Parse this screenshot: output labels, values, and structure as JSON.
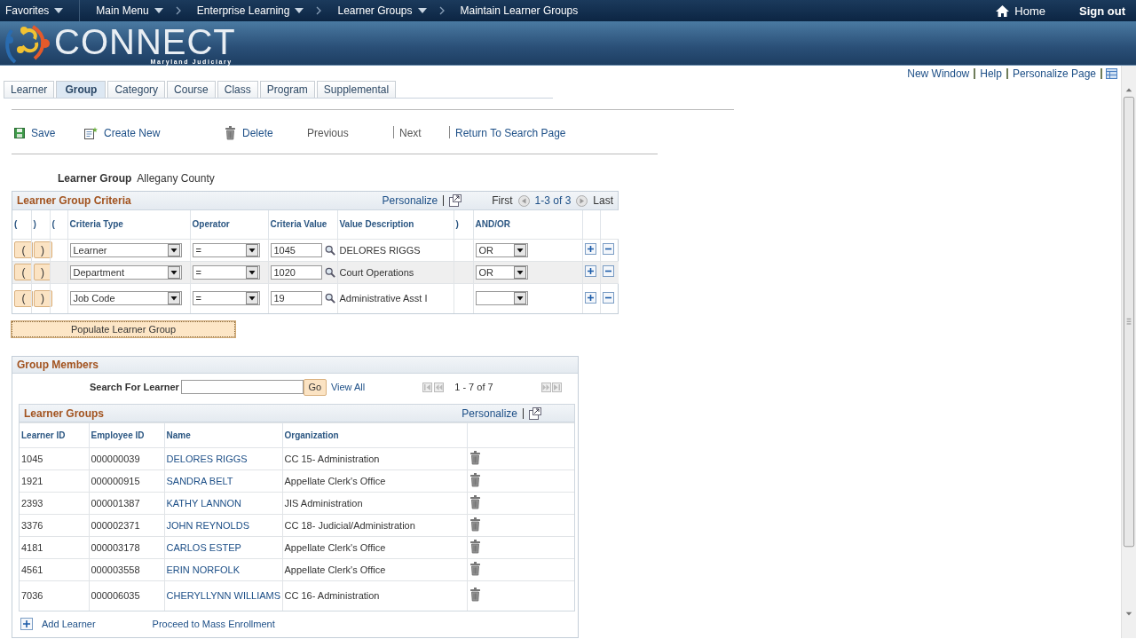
{
  "nav": {
    "items": [
      {
        "label": "Favorites",
        "menu": true,
        "divider_after": true
      },
      {
        "label": "Main Menu",
        "menu": true,
        "divider_after": false
      },
      {
        "label": "Enterprise Learning",
        "menu": true,
        "divider_after": false
      },
      {
        "label": "Learner Groups",
        "menu": true,
        "divider_after": false
      },
      {
        "label": "Maintain Learner Groups",
        "menu": false,
        "divider_after": false
      }
    ],
    "home": "Home",
    "sign_out": "Sign out"
  },
  "banner": {
    "logo_text": "CONNECT",
    "logo_subtitle": "Maryland Judiciary"
  },
  "page_links": [
    "New Window",
    "Help",
    "Personalize Page"
  ],
  "tabs": [
    {
      "label": "Learner",
      "selected": false
    },
    {
      "label": "Group",
      "selected": true
    },
    {
      "label": "Category",
      "selected": false
    },
    {
      "label": "Course",
      "selected": false
    },
    {
      "label": "Class",
      "selected": false
    },
    {
      "label": "Program",
      "selected": false
    },
    {
      "label": "Supplemental",
      "selected": false
    }
  ],
  "toolbar": [
    {
      "label": "Save",
      "kind": "save",
      "disabled": false,
      "divider_before": false
    },
    {
      "label": "Create New",
      "kind": "create",
      "disabled": false,
      "divider_before": false
    },
    {
      "label": "Delete",
      "kind": "delete",
      "disabled": false,
      "divider_before": false
    },
    {
      "label": "Previous",
      "kind": "nav",
      "disabled": true,
      "divider_before": false
    },
    {
      "label": "Next",
      "kind": "nav",
      "disabled": true,
      "divider_before": true
    },
    {
      "label": "Return To Search Page",
      "kind": "nav",
      "disabled": false,
      "divider_before": true
    }
  ],
  "learner_group": {
    "label": "Learner Group",
    "value": "Allegany County"
  },
  "criteria": {
    "title": "Learner Group Criteria",
    "personalize": "Personalize",
    "first": "First",
    "range": "1-3 of 3",
    "last": "Last",
    "columns": [
      "(",
      ")",
      "(",
      "Criteria Type",
      "Operator",
      "Criteria Value",
      "Value Description",
      ")",
      "AND/OR"
    ],
    "rows": [
      {
        "open": "(",
        "close": ")",
        "criteria_type": "Learner",
        "operator": "=",
        "value": "1045",
        "description": "DELORES RIGGS",
        "and_or": "OR",
        "selected": false
      },
      {
        "open": "(",
        "close": ")",
        "criteria_type": "Department",
        "operator": "=",
        "value": "1020",
        "description": "Court Operations",
        "and_or": "OR",
        "selected": true
      },
      {
        "open": "(",
        "close": ")",
        "criteria_type": "Job Code",
        "operator": "=",
        "value": "19",
        "description": "Administrative Asst I",
        "selected": false
      }
    ]
  },
  "populate_button": "Populate Learner Group",
  "members": {
    "title": "Group Members",
    "search_label": "Search For Learner",
    "go": "Go",
    "view_all": "View All",
    "range": "1 - 7 of 7",
    "grid": {
      "title": "Learner Groups",
      "personalize": "Personalize",
      "columns": [
        "Learner ID",
        "Employee ID",
        "Name",
        "Organization"
      ],
      "rows": [
        {
          "learner_id": "1045",
          "employee_id": "000000039",
          "name": "DELORES RIGGS",
          "organization": "CC 15- Administration"
        },
        {
          "learner_id": "1921",
          "employee_id": "000000915",
          "name": "SANDRA BELT",
          "organization": "Appellate Clerk's Office"
        },
        {
          "learner_id": "2393",
          "employee_id": "000001387",
          "name": "KATHY LANNON",
          "organization": "JIS Administration"
        },
        {
          "learner_id": "3376",
          "employee_id": "000002371",
          "name": "JOHN REYNOLDS",
          "organization": "CC 18- Judicial/Administration"
        },
        {
          "learner_id": "4181",
          "employee_id": "000003178",
          "name": "CARLOS ESTEP",
          "organization": "Appellate Clerk's Office"
        },
        {
          "learner_id": "4561",
          "employee_id": "000003558",
          "name": "ERIN NORFOLK",
          "organization": "Appellate Clerk's Office"
        },
        {
          "learner_id": "7036",
          "employee_id": "000006035",
          "name": "CHERYLLYNN WILLIAMS",
          "organization": "CC 16- Administration"
        }
      ]
    },
    "add_learner": "Add Learner",
    "mass_enrollment": "Proceed to Mass Enrollment"
  }
}
